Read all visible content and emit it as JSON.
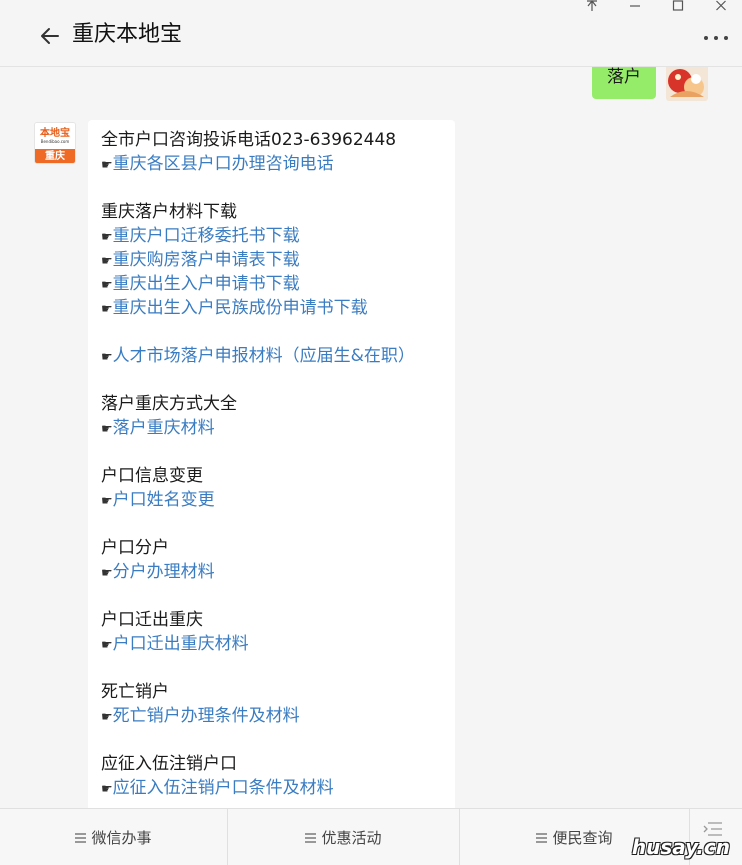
{
  "window": {
    "controls": [
      "pin",
      "minimize",
      "maximize",
      "close"
    ]
  },
  "header": {
    "title": "重庆本地宝",
    "back_icon": "arrow-left-icon",
    "more_icon": "more-dots-icon"
  },
  "chat": {
    "user_message": "落户",
    "bot": {
      "avatar_brand": "本地宝",
      "avatar_site": "Bendibao.com",
      "avatar_city": "重庆",
      "hand_glyph": "☛",
      "lines": [
        {
          "type": "text",
          "text": "全市户口咨询投诉电话023-63962448"
        },
        {
          "type": "link",
          "text": "重庆各区县户口办理咨询电话"
        },
        {
          "type": "gap"
        },
        {
          "type": "text",
          "text": "重庆落户材料下载"
        },
        {
          "type": "link",
          "text": "重庆户口迁移委托书下载"
        },
        {
          "type": "link",
          "text": "重庆购房落户申请表下载"
        },
        {
          "type": "link",
          "text": "重庆出生入户申请书下载"
        },
        {
          "type": "link",
          "text": "重庆出生入户民族成份申请书下载"
        },
        {
          "type": "gap"
        },
        {
          "type": "link",
          "text": "人才市场落户申报材料（应届生&在职）"
        },
        {
          "type": "gap"
        },
        {
          "type": "text",
          "text": "落户重庆方式大全"
        },
        {
          "type": "link",
          "text": "落户重庆材料"
        },
        {
          "type": "gap"
        },
        {
          "type": "text",
          "text": "户口信息变更"
        },
        {
          "type": "link",
          "text": "户口姓名变更"
        },
        {
          "type": "gap"
        },
        {
          "type": "text",
          "text": "户口分户"
        },
        {
          "type": "link",
          "text": "分户办理材料"
        },
        {
          "type": "gap"
        },
        {
          "type": "text",
          "text": "户口迁出重庆"
        },
        {
          "type": "link",
          "text": "户口迁出重庆材料"
        },
        {
          "type": "gap"
        },
        {
          "type": "text",
          "text": "死亡销户"
        },
        {
          "type": "link",
          "text": "死亡销户办理条件及材料"
        },
        {
          "type": "gap"
        },
        {
          "type": "text",
          "text": "应征入伍注销户口"
        },
        {
          "type": "link",
          "text": "应征入伍注销户口条件及材料"
        }
      ]
    }
  },
  "menu": {
    "items": [
      "微信办事",
      "优惠活动",
      "便民查询"
    ],
    "watermark": "husay.cn"
  },
  "colors": {
    "link": "#3a7cc2",
    "bubble_user": "#95ec69",
    "brand_orange": "#ef6a24"
  }
}
